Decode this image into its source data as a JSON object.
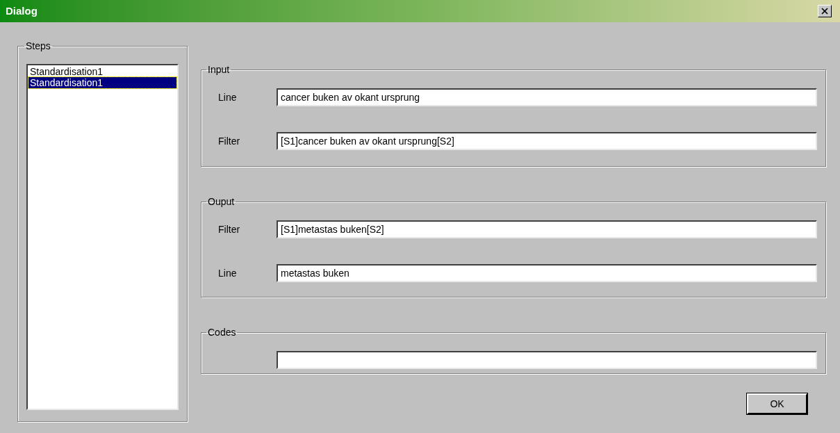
{
  "window": {
    "title": "Dialog"
  },
  "steps": {
    "label": "Steps",
    "items": [
      {
        "label": "Standardisation1",
        "selected": false
      },
      {
        "label": "Standardisation1",
        "selected": true
      }
    ]
  },
  "groups": [
    {
      "title": "Input",
      "fields": [
        {
          "kind": "textbox",
          "label": "Line",
          "value": "cancer buken av okant ursprung"
        },
        {
          "kind": "textbox",
          "label": "Filter",
          "value": "[S1]cancer buken av okant ursprung[S2]"
        }
      ]
    },
    {
      "title": "Ouput",
      "fields": [
        {
          "kind": "textbox",
          "label": "Filter",
          "value": "[S1]metastas buken[S2]"
        },
        {
          "kind": "textbox",
          "label": "Line",
          "value": "metastas buken"
        }
      ]
    },
    {
      "title": "Codes",
      "fields": [
        {
          "kind": "textbox"
        }
      ]
    }
  ],
  "buttons": [
    "OK"
  ]
}
